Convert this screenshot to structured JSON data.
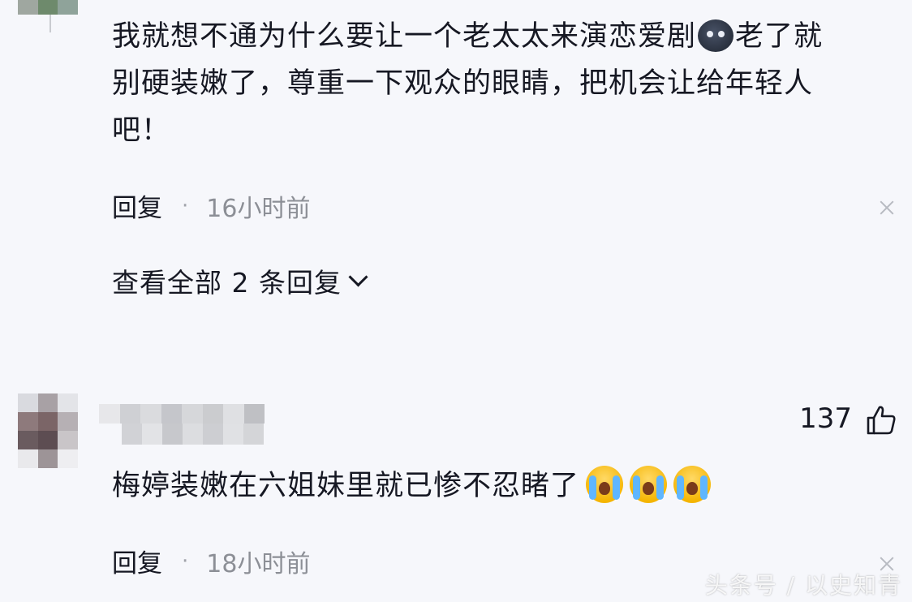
{
  "comment1": {
    "lines": [
      "我就想不通为什么要让一个老太太来演恋爱剧",
      "老了就",
      "别硬装嫩了，尊重一下观众的眼睛，把机会让给年轻人",
      "吧！"
    ],
    "emoji": "dark-face-emoji",
    "reply_label": "回复",
    "separator": "·",
    "time": "16小时前"
  },
  "view_replies_label": "查看全部 2 条回复",
  "comment2": {
    "like_count": "137",
    "text": "梅婷装嫩在六姐妹里就已惨不忍睹了",
    "emojis": [
      "crying-face-emoji",
      "crying-face-emoji",
      "crying-face-emoji"
    ],
    "reply_label": "回复",
    "separator": "·",
    "time": "18小时前"
  },
  "watermark": "头条号 / 以史知青",
  "colors": {
    "background": "#f6f7fb",
    "text": "#161823",
    "meta": "#8c8f96"
  }
}
